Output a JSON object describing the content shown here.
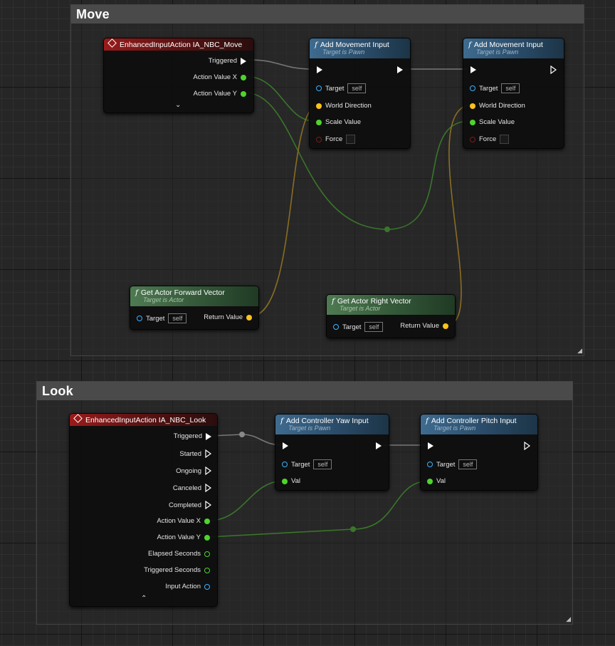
{
  "colors": {
    "exec": "#ffffff",
    "float_pin": "#4ed42e",
    "vector_pin": "#ffc21b",
    "object_pin": "#3cb2ff",
    "event_header": "#9a1b1b",
    "function_header": "#3e6b8f",
    "pure_header": "#4e7a52"
  },
  "move": {
    "title": "Move",
    "event": {
      "title": "EnhancedInputAction IA_NBC_Move",
      "pins": [
        "Triggered",
        "Action Value X",
        "Action Value Y"
      ]
    },
    "add1": {
      "title": "Add Movement Input",
      "subtitle": "Target is Pawn",
      "target": "Target",
      "self": "self",
      "world_direction": "World Direction",
      "scale_value": "Scale Value",
      "force": "Force"
    },
    "add2": {
      "title": "Add Movement Input",
      "subtitle": "Target is Pawn",
      "target": "Target",
      "self": "self",
      "world_direction": "World Direction",
      "scale_value": "Scale Value",
      "force": "Force"
    },
    "forward": {
      "title": "Get Actor Forward Vector",
      "subtitle": "Target is Actor",
      "target": "Target",
      "self": "self",
      "return_value": "Return Value"
    },
    "right": {
      "title": "Get Actor Right Vector",
      "subtitle": "Target is Actor",
      "target": "Target",
      "self": "self",
      "return_value": "Return Value"
    }
  },
  "look": {
    "title": "Look",
    "event": {
      "title": "EnhancedInputAction IA_NBC_Look",
      "pins": [
        "Triggered",
        "Started",
        "Ongoing",
        "Canceled",
        "Completed",
        "Action Value X",
        "Action Value Y",
        "Elapsed Seconds",
        "Triggered Seconds",
        "Input Action"
      ]
    },
    "yaw": {
      "title": "Add Controller Yaw Input",
      "subtitle": "Target is Pawn",
      "target": "Target",
      "self": "self",
      "val": "Val"
    },
    "pitch": {
      "title": "Add Controller Pitch Input",
      "subtitle": "Target is Pawn",
      "target": "Target",
      "self": "self",
      "val": "Val"
    }
  }
}
